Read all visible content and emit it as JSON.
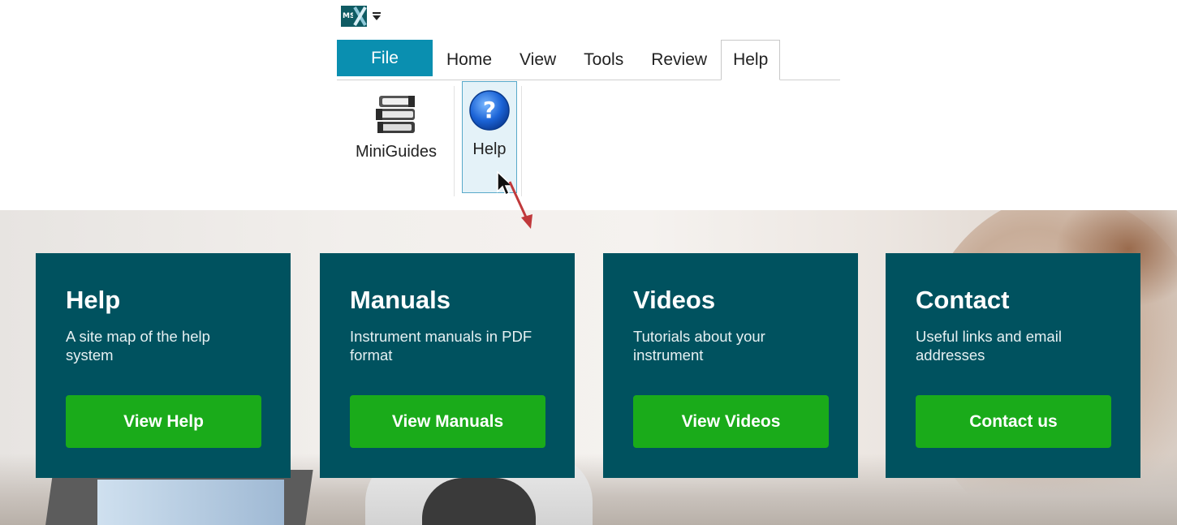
{
  "app": {
    "logo_text": "MS"
  },
  "ribbon": {
    "tabs": [
      {
        "label": "File"
      },
      {
        "label": "Home"
      },
      {
        "label": "View"
      },
      {
        "label": "Tools"
      },
      {
        "label": "Review"
      },
      {
        "label": "Help"
      }
    ],
    "active_tab": "Help",
    "buttons": {
      "miniguides": {
        "label": "MiniGuides",
        "icon": "books-icon"
      },
      "help": {
        "label": "Help",
        "icon": "question-icon"
      }
    }
  },
  "cards": [
    {
      "title": "Help",
      "description": "A site map of the help system",
      "button": "View Help"
    },
    {
      "title": "Manuals",
      "description": "Instrument manuals in PDF format",
      "button": "View Manuals"
    },
    {
      "title": "Videos",
      "description": "Tutorials about your instrument",
      "button": "View Videos"
    },
    {
      "title": "Contact",
      "description": "Useful links and email addresses",
      "button": "Contact us"
    }
  ],
  "colors": {
    "file_tab": "#0a8fb0",
    "card_bg": "#00525f",
    "cta_green": "#1aab1a",
    "arrow_red": "#c0393b"
  }
}
